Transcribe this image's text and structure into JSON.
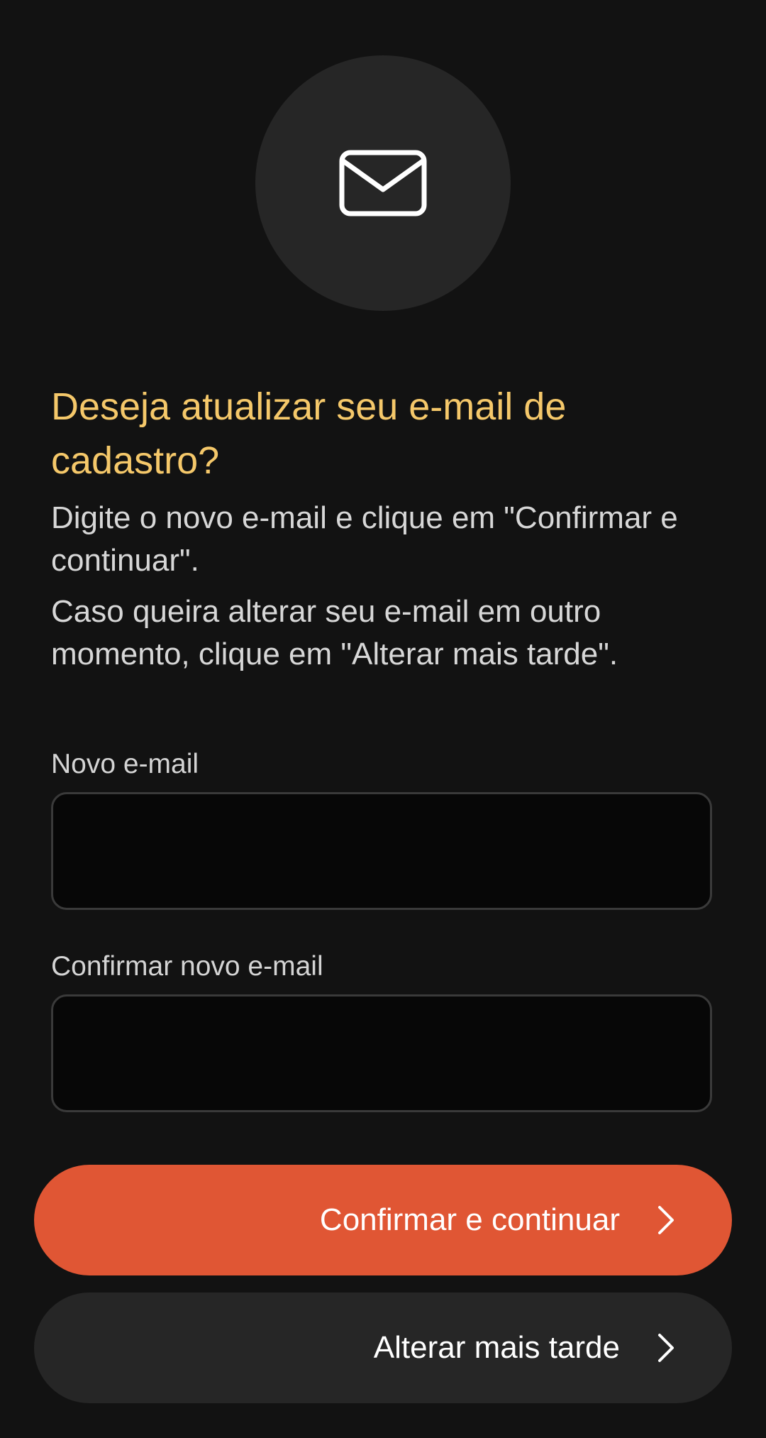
{
  "header": {
    "icon": "envelope-icon"
  },
  "content": {
    "title": "Deseja atualizar seu e-mail de cadastro?",
    "description_1": "Digite o novo e-mail e clique em \"Confirmar e continuar\".",
    "description_2": "Caso queira alterar seu e-mail em outro momento, clique em \"Alterar mais tarde\"."
  },
  "form": {
    "new_email_label": "Novo e-mail",
    "new_email_value": "",
    "confirm_email_label": "Confirmar novo e-mail",
    "confirm_email_value": ""
  },
  "actions": {
    "confirm_label": "Confirmar e continuar",
    "later_label": "Alterar mais tarde",
    "chevron_icon": "chevron-right-icon"
  },
  "colors": {
    "background": "#121212",
    "title": "#f5c86a",
    "primary_button": "#e05634",
    "secondary_button": "#262626"
  }
}
